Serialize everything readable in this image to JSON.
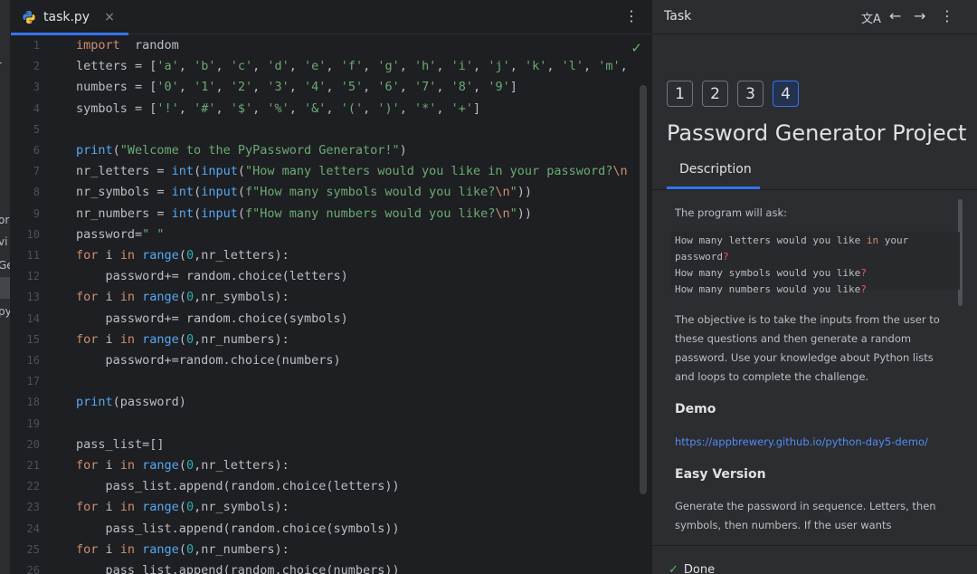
{
  "left_strip": {
    "fragments": [
      "or",
      "vi",
      "Ge",
      "py"
    ]
  },
  "editor": {
    "tab": {
      "filename": "task.py",
      "close_glyph": "×"
    },
    "kebab_glyph": "⋮",
    "check_glyph": "✓",
    "line_numbers": [
      "1",
      "2",
      "3",
      "4",
      "5",
      "6",
      "7",
      "8",
      "9",
      "10",
      "11",
      "12",
      "13",
      "14",
      "15",
      "16",
      "17",
      "18",
      "19",
      "20",
      "21",
      "22",
      "23",
      "24",
      "25",
      "26"
    ],
    "lines": [
      [
        [
          "kw",
          "import"
        ],
        [
          "",
          "  random"
        ]
      ],
      [
        [
          "",
          "letters = ["
        ],
        [
          "st",
          "'a'"
        ],
        [
          "",
          ", "
        ],
        [
          "st",
          "'b'"
        ],
        [
          "",
          ", "
        ],
        [
          "st",
          "'c'"
        ],
        [
          "",
          ", "
        ],
        [
          "st",
          "'d'"
        ],
        [
          "",
          ", "
        ],
        [
          "st",
          "'e'"
        ],
        [
          "",
          ", "
        ],
        [
          "st",
          "'f'"
        ],
        [
          "",
          ", "
        ],
        [
          "st",
          "'g'"
        ],
        [
          "",
          ", "
        ],
        [
          "st",
          "'h'"
        ],
        [
          "",
          ", "
        ],
        [
          "st",
          "'i'"
        ],
        [
          "",
          ", "
        ],
        [
          "st",
          "'j'"
        ],
        [
          "",
          ", "
        ],
        [
          "st",
          "'k'"
        ],
        [
          "",
          ", "
        ],
        [
          "st",
          "'l'"
        ],
        [
          "",
          ", "
        ],
        [
          "st",
          "'m'"
        ],
        [
          "",
          ","
        ]
      ],
      [
        [
          "",
          "numbers = ["
        ],
        [
          "st",
          "'0'"
        ],
        [
          "",
          ", "
        ],
        [
          "st",
          "'1'"
        ],
        [
          "",
          ", "
        ],
        [
          "st",
          "'2'"
        ],
        [
          "",
          ", "
        ],
        [
          "st",
          "'3'"
        ],
        [
          "",
          ", "
        ],
        [
          "st",
          "'4'"
        ],
        [
          "",
          ", "
        ],
        [
          "st",
          "'5'"
        ],
        [
          "",
          ", "
        ],
        [
          "st",
          "'6'"
        ],
        [
          "",
          ", "
        ],
        [
          "st",
          "'7'"
        ],
        [
          "",
          ", "
        ],
        [
          "st",
          "'8'"
        ],
        [
          "",
          ", "
        ],
        [
          "st",
          "'9'"
        ],
        [
          "",
          "]"
        ]
      ],
      [
        [
          "",
          "symbols = ["
        ],
        [
          "st",
          "'!'"
        ],
        [
          "",
          ", "
        ],
        [
          "st",
          "'#'"
        ],
        [
          "",
          ", "
        ],
        [
          "st",
          "'$'"
        ],
        [
          "",
          ", "
        ],
        [
          "st",
          "'%'"
        ],
        [
          "",
          ", "
        ],
        [
          "st",
          "'&'"
        ],
        [
          "",
          ", "
        ],
        [
          "st",
          "'('"
        ],
        [
          "",
          ", "
        ],
        [
          "st",
          "')'"
        ],
        [
          "",
          ", "
        ],
        [
          "st",
          "'*'"
        ],
        [
          "",
          ", "
        ],
        [
          "st",
          "'+'"
        ],
        [
          "",
          "]"
        ]
      ],
      [],
      [
        [
          "bi",
          "print"
        ],
        [
          "",
          "("
        ],
        [
          "st",
          "\"Welcome to the PyPassword Generator!\""
        ],
        [
          "",
          ")"
        ]
      ],
      [
        [
          "",
          "nr_letters = "
        ],
        [
          "bi",
          "int"
        ],
        [
          "",
          "("
        ],
        [
          "bi",
          "input"
        ],
        [
          "",
          "("
        ],
        [
          "st",
          "\"How many letters would you like in your password?"
        ],
        [
          "esc",
          "\\n"
        ]
      ],
      [
        [
          "",
          "nr_symbols = "
        ],
        [
          "bi",
          "int"
        ],
        [
          "",
          "("
        ],
        [
          "bi",
          "input"
        ],
        [
          "",
          "("
        ],
        [
          "st",
          "f\"How many symbols would you like?"
        ],
        [
          "esc",
          "\\n"
        ],
        [
          "st",
          "\""
        ],
        [
          "",
          "))"
        ]
      ],
      [
        [
          "",
          "nr_numbers = "
        ],
        [
          "bi",
          "int"
        ],
        [
          "",
          "("
        ],
        [
          "bi",
          "input"
        ],
        [
          "",
          "("
        ],
        [
          "st",
          "f\"How many numbers would you like?"
        ],
        [
          "esc",
          "\\n"
        ],
        [
          "st",
          "\""
        ],
        [
          "",
          "))"
        ]
      ],
      [
        [
          "",
          "password="
        ],
        [
          "st",
          "\" \""
        ]
      ],
      [
        [
          "kw",
          "for"
        ],
        [
          "",
          " i "
        ],
        [
          "kw",
          "in"
        ],
        [
          "",
          ""
        ],
        [
          "bi",
          " range"
        ],
        [
          "",
          "("
        ],
        [
          "nm",
          "0"
        ],
        [
          "",
          ",nr_letters):"
        ]
      ],
      [
        [
          "",
          "    password+= random.choice(letters)"
        ]
      ],
      [
        [
          "kw",
          "for"
        ],
        [
          "",
          " i "
        ],
        [
          "kw",
          "in"
        ],
        [
          "bi",
          " range"
        ],
        [
          "",
          "("
        ],
        [
          "nm",
          "0"
        ],
        [
          "",
          ",nr_symbols):"
        ]
      ],
      [
        [
          "",
          "    password+= random.choice(symbols)"
        ]
      ],
      [
        [
          "kw",
          "for"
        ],
        [
          "",
          " i "
        ],
        [
          "kw",
          "in"
        ],
        [
          "bi",
          " range"
        ],
        [
          "",
          "("
        ],
        [
          "nm",
          "0"
        ],
        [
          "",
          ",nr_numbers):"
        ]
      ],
      [
        [
          "",
          "    password+=random.choice(numbers)"
        ]
      ],
      [],
      [
        [
          "bi",
          "print"
        ],
        [
          "",
          "(password)"
        ]
      ],
      [],
      [
        [
          "",
          "pass_list=[]"
        ]
      ],
      [
        [
          "kw",
          "for"
        ],
        [
          "",
          " i "
        ],
        [
          "kw",
          "in"
        ],
        [
          "bi",
          " range"
        ],
        [
          "",
          "("
        ],
        [
          "nm",
          "0"
        ],
        [
          "",
          ",nr_letters):"
        ]
      ],
      [
        [
          "",
          "    pass_list.append(random.choice(letters))"
        ]
      ],
      [
        [
          "kw",
          "for"
        ],
        [
          "",
          " i "
        ],
        [
          "kw",
          "in"
        ],
        [
          "bi",
          " range"
        ],
        [
          "",
          "("
        ],
        [
          "nm",
          "0"
        ],
        [
          "",
          ",nr_symbols):"
        ]
      ],
      [
        [
          "",
          "    pass_list.append(random.choice(symbols))"
        ]
      ],
      [
        [
          "kw",
          "for"
        ],
        [
          "",
          " i "
        ],
        [
          "kw",
          "in"
        ],
        [
          "bi",
          " range"
        ],
        [
          "",
          "("
        ],
        [
          "nm",
          "0"
        ],
        [
          "",
          ",nr_numbers):"
        ]
      ],
      [
        [
          "",
          "    pass_list.append(random.choice(numbers))"
        ]
      ]
    ]
  },
  "panel": {
    "title": "Task",
    "header_icons": {
      "translate": "文A",
      "back": "←",
      "forward": "→",
      "more": "⋮"
    },
    "steps": [
      "1",
      "2",
      "3",
      "4"
    ],
    "active_step": "4",
    "project_title": "Password Generator Project",
    "tab_description": "Description",
    "intro": "The program will ask:",
    "questions": [
      [
        [
          "",
          "How many letters would you like "
        ],
        [
          "kw",
          "in"
        ],
        [
          "",
          " your"
        ]
      ],
      [
        [
          "",
          "password"
        ],
        [
          "q",
          "?"
        ]
      ],
      [
        [
          "",
          "How many symbols would you like"
        ],
        [
          "q",
          "?"
        ]
      ],
      [
        [
          "",
          "How many numbers would you like"
        ],
        [
          "q",
          "?"
        ]
      ]
    ],
    "objective": "The objective is to take the inputs from the user to these questions and then generate a random password. Use your knowledge about Python lists and loops to complete the challenge.",
    "demo_heading": "Demo",
    "demo_link": "https://appbrewery.github.io/python-day5-demo/",
    "easy_heading": "Easy Version",
    "easy_text": "Generate the password in sequence. Letters, then symbols, then numbers. If the user wants",
    "done_label": "Done",
    "done_glyph": "✓"
  },
  "colors": {
    "accent": "#3574f0",
    "keyword": "#cf8e6d",
    "string": "#6aab73",
    "builtin": "#56a8f5",
    "number": "#2aacb8",
    "link": "#548af7"
  }
}
